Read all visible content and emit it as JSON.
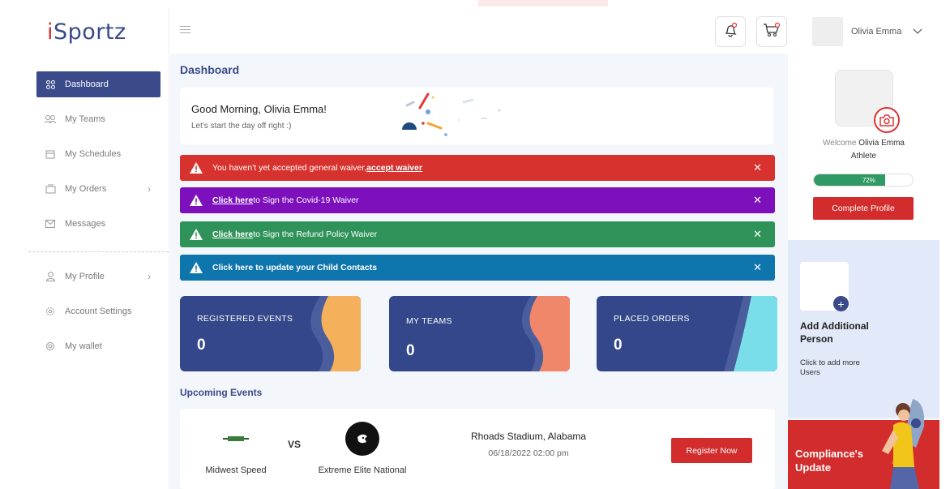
{
  "brand": {
    "name_prefix": "i",
    "name": "Sportz"
  },
  "sidebar": {
    "items": [
      {
        "label": "Dashboard",
        "icon": "grid-icon",
        "active": true
      },
      {
        "label": "My Teams",
        "icon": "teams-icon"
      },
      {
        "label": "My Schedules",
        "icon": "calendar-icon"
      },
      {
        "label": "My Orders",
        "icon": "orders-icon",
        "chevron": true
      },
      {
        "label": "Messages",
        "icon": "mail-icon"
      }
    ],
    "items2": [
      {
        "label": "My Profile",
        "icon": "user-icon",
        "chevron": true
      },
      {
        "label": "Account Settings",
        "icon": "gear-icon"
      },
      {
        "label": "My wallet",
        "icon": "wallet-icon"
      }
    ]
  },
  "header": {
    "user_name": "Olivia Emma"
  },
  "main": {
    "title": "Dashboard",
    "greeting": {
      "title": "Good Morning, Olivia Emma!",
      "subtitle": "Let's start the day off right :)"
    },
    "alerts": [
      {
        "text": "You haven't yet accepted general waiver, ",
        "link": "accept waiver",
        "color": "#d8322e"
      },
      {
        "link": "Click here",
        "text": " to Sign the Covid-19 Waiver",
        "color": "#7d0fbd"
      },
      {
        "link": "Click here",
        "text": " to Sign the Refund Policy  Waiver",
        "color": "#2f9359"
      },
      {
        "text": "Click here to update your Child Contacts",
        "color": "#0f75ad"
      }
    ],
    "cards": [
      {
        "label": "REGISTERED  EVENTS",
        "value": "0",
        "accent": "#f5b05c"
      },
      {
        "label": "MY TEAMS",
        "value": "0",
        "accent": "#f0876a"
      },
      {
        "label": "PLACED ORDERS",
        "value": "0",
        "accent": "#79ddea"
      }
    ],
    "upcoming": {
      "title": "Upcoming Events",
      "team1": "Midwest Speed",
      "vs": "VS",
      "team2": "Extreme Elite National",
      "venue": "Rhoads Stadium, Alabama",
      "datetime": "06/18/2022 02:00 pm",
      "register": "Register Now"
    }
  },
  "right": {
    "welcome_prefix": "Welcome ",
    "welcome_name": "Olivia Emma",
    "role": "Athlete",
    "progress_label": "72%",
    "progress": 0.72,
    "complete_btn": "Complete Profile",
    "add_title": "Add Additional Person",
    "add_sub": "Click to add more Users",
    "compliance": "Compliance's Update"
  }
}
